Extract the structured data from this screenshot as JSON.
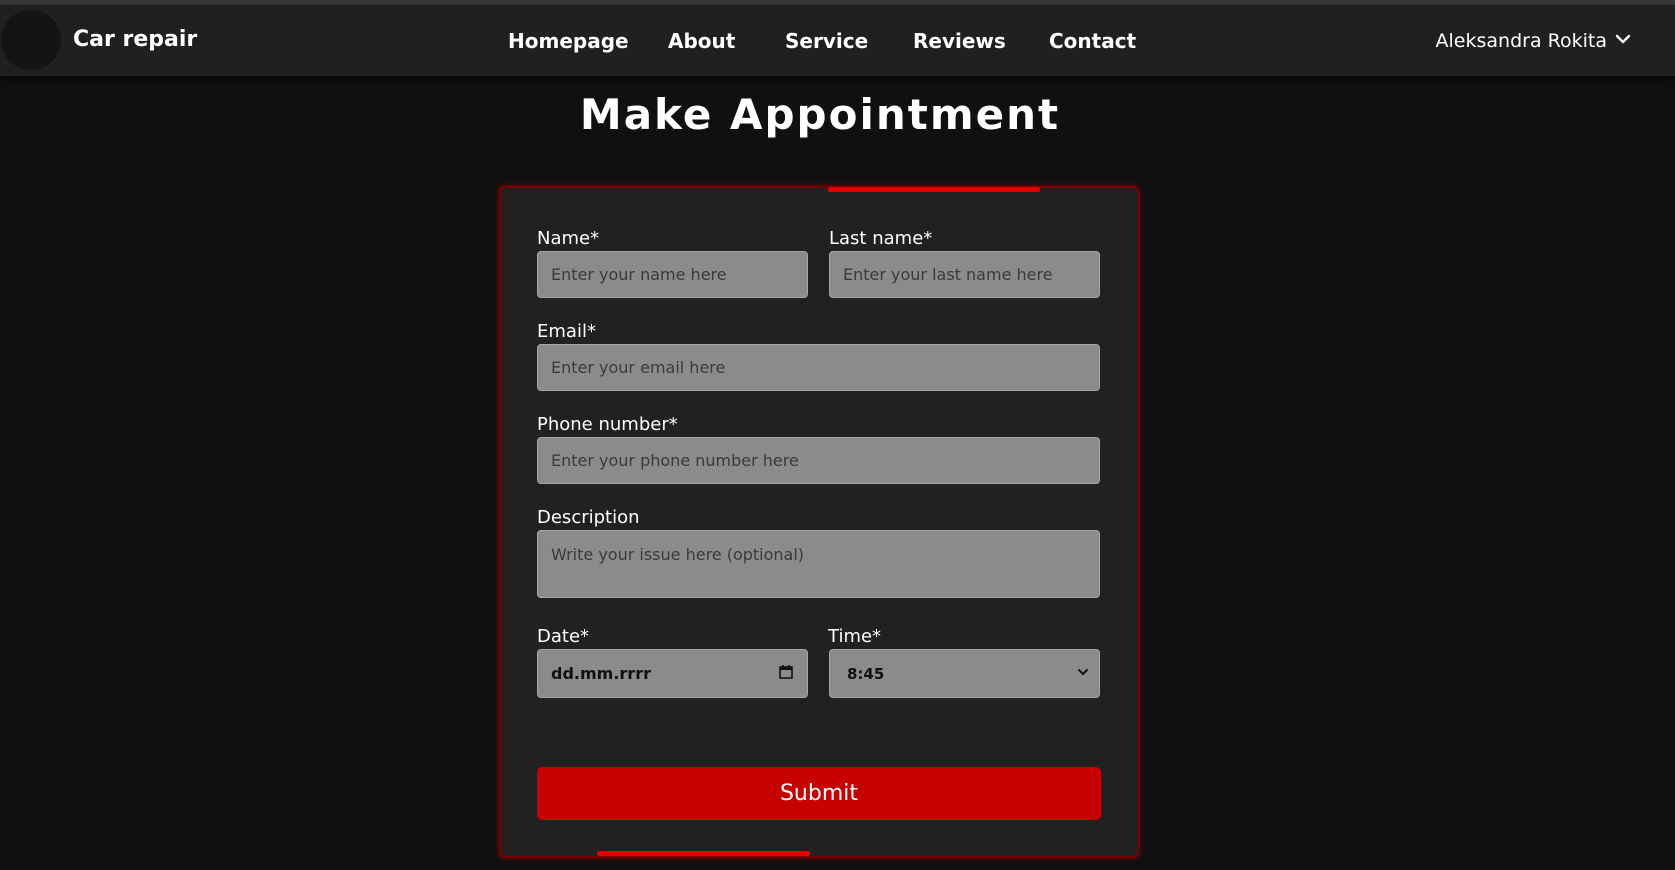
{
  "navbar": {
    "brand": "Car repair",
    "links": [
      "Homepage",
      "About",
      "Service",
      "Reviews",
      "Contact"
    ],
    "user_name": "Aleksandra Rokita"
  },
  "page": {
    "title": "Make Appointment"
  },
  "form": {
    "name_label": "Name*",
    "name_placeholder": "Enter your name here",
    "last_name_label": "Last name*",
    "last_name_placeholder": "Enter your last name here",
    "email_label": "Email*",
    "email_placeholder": "Enter your email here",
    "phone_label": "Phone number*",
    "phone_placeholder": "Enter your phone number here",
    "description_label": "Description",
    "description_placeholder": "Write your issue here (optional)",
    "date_label": "Date*",
    "date_value": "dd.mm.rrrr",
    "time_label": "Time*",
    "time_value": "8:45",
    "submit_label": "Submit"
  },
  "colors": {
    "accent": "#c70000",
    "background": "#101010",
    "card": "#212121",
    "field": "#8b8b8b"
  }
}
